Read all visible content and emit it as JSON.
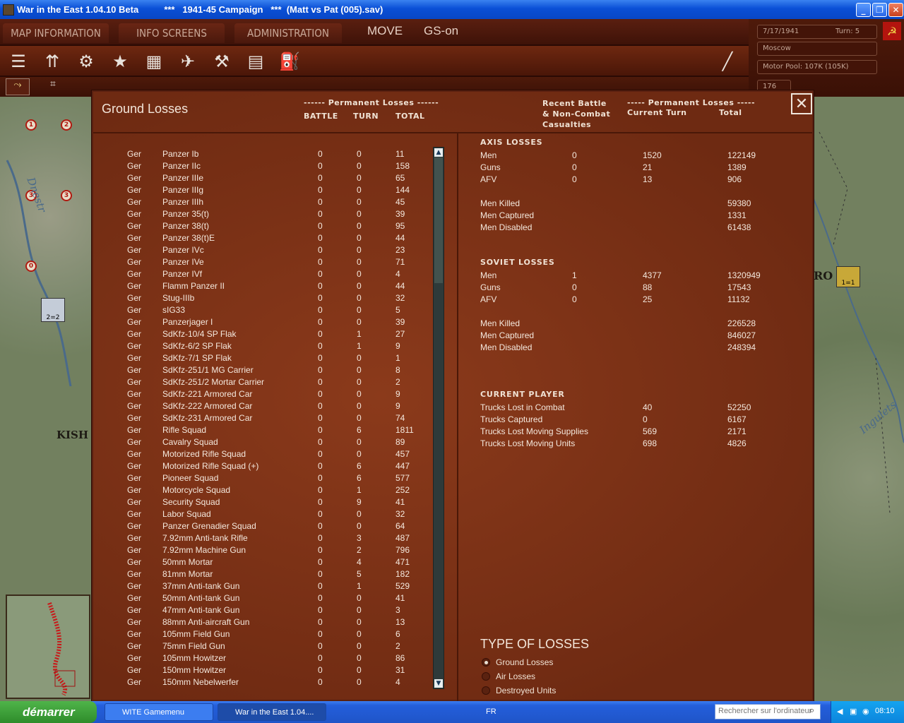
{
  "window": {
    "title": "War in the East 1.04.10 Beta          ***   1941-45 Campaign   ***  (Matt vs Pat (005).sav)"
  },
  "topbar": {
    "menus": [
      "MAP INFORMATION",
      "INFO SCREENS",
      "ADMINISTRATION"
    ],
    "mode": "MOVE",
    "gs": "GS-on"
  },
  "info": {
    "date": "7/17/1941",
    "turn": "Turn: 5",
    "location": "Moscow",
    "motor_pool": "Motor Pool: 107K (105K)",
    "count": "176"
  },
  "dialog": {
    "title": "Ground Losses",
    "left_header_group": "------ Permanent Losses ------",
    "col_battle": "BATTLE",
    "col_turn": "TURN",
    "col_total": "TOTAL",
    "right_header_1": "Recent Battle\n& Non-Combat\nCasualties",
    "right_header_group": "----- Permanent Losses -----",
    "right_col_current": "Current Turn",
    "right_col_total": "Total",
    "close": "✕"
  },
  "rows": [
    [
      "Ger",
      "Panzer Ib",
      "0",
      "0",
      "11"
    ],
    [
      "Ger",
      "Panzer IIc",
      "0",
      "0",
      "158"
    ],
    [
      "Ger",
      "Panzer IIIe",
      "0",
      "0",
      "65"
    ],
    [
      "Ger",
      "Panzer IIIg",
      "0",
      "0",
      "144"
    ],
    [
      "Ger",
      "Panzer IIIh",
      "0",
      "0",
      "45"
    ],
    [
      "Ger",
      "Panzer 35(t)",
      "0",
      "0",
      "39"
    ],
    [
      "Ger",
      "Panzer 38(t)",
      "0",
      "0",
      "95"
    ],
    [
      "Ger",
      "Panzer 38(t)E",
      "0",
      "0",
      "44"
    ],
    [
      "Ger",
      "Panzer IVc",
      "0",
      "0",
      "23"
    ],
    [
      "Ger",
      "Panzer IVe",
      "0",
      "0",
      "71"
    ],
    [
      "Ger",
      "Panzer IVf",
      "0",
      "0",
      "4"
    ],
    [
      "Ger",
      "Flamm Panzer II",
      "0",
      "0",
      "44"
    ],
    [
      "Ger",
      "Stug-IIIb",
      "0",
      "0",
      "32"
    ],
    [
      "Ger",
      "sIG33",
      "0",
      "0",
      "5"
    ],
    [
      "Ger",
      "Panzerjager I",
      "0",
      "0",
      "39"
    ],
    [
      "Ger",
      "SdKfz-10/4 SP Flak",
      "0",
      "1",
      "27"
    ],
    [
      "Ger",
      "SdKfz-6/2 SP Flak",
      "0",
      "1",
      "9"
    ],
    [
      "Ger",
      "SdKfz-7/1 SP Flak",
      "0",
      "0",
      "1"
    ],
    [
      "Ger",
      "SdKfz-251/1 MG Carrier",
      "0",
      "0",
      "8"
    ],
    [
      "Ger",
      "SdKfz-251/2 Mortar Carrier",
      "0",
      "0",
      "2"
    ],
    [
      "Ger",
      "SdKfz-221 Armored Car",
      "0",
      "0",
      "9"
    ],
    [
      "Ger",
      "SdKfz-222 Armored Car",
      "0",
      "0",
      "9"
    ],
    [
      "Ger",
      "SdKfz-231 Armored Car",
      "0",
      "0",
      "74"
    ],
    [
      "Ger",
      "Rifle Squad",
      "0",
      "6",
      "1811"
    ],
    [
      "Ger",
      "Cavalry Squad",
      "0",
      "0",
      "89"
    ],
    [
      "Ger",
      "Motorized Rifle Squad",
      "0",
      "0",
      "457"
    ],
    [
      "Ger",
      "Motorized Rifle Squad (+)",
      "0",
      "6",
      "447"
    ],
    [
      "Ger",
      "Pioneer Squad",
      "0",
      "6",
      "577"
    ],
    [
      "Ger",
      "Motorcycle Squad",
      "0",
      "1",
      "252"
    ],
    [
      "Ger",
      "Security Squad",
      "0",
      "9",
      "41"
    ],
    [
      "Ger",
      "Labor Squad",
      "0",
      "0",
      "32"
    ],
    [
      "Ger",
      "Panzer Grenadier Squad",
      "0",
      "0",
      "64"
    ],
    [
      "Ger",
      "7.92mm Anti-tank Rifle",
      "0",
      "3",
      "487"
    ],
    [
      "Ger",
      "7.92mm Machine Gun",
      "0",
      "2",
      "796"
    ],
    [
      "Ger",
      "50mm Mortar",
      "0",
      "4",
      "471"
    ],
    [
      "Ger",
      "81mm Mortar",
      "0",
      "5",
      "182"
    ],
    [
      "Ger",
      "37mm Anti-tank Gun",
      "0",
      "1",
      "529"
    ],
    [
      "Ger",
      "50mm Anti-tank Gun",
      "0",
      "0",
      "41"
    ],
    [
      "Ger",
      "47mm Anti-tank Gun",
      "0",
      "0",
      "3"
    ],
    [
      "Ger",
      "88mm Anti-aircraft Gun",
      "0",
      "0",
      "13"
    ],
    [
      "Ger",
      "105mm Field Gun",
      "0",
      "0",
      "6"
    ],
    [
      "Ger",
      "75mm Field Gun",
      "0",
      "0",
      "2"
    ],
    [
      "Ger",
      "105mm Howitzer",
      "0",
      "0",
      "86"
    ],
    [
      "Ger",
      "150mm Howitzer",
      "0",
      "0",
      "31"
    ],
    [
      "Ger",
      "150mm Nebelwerfer",
      "0",
      "0",
      "4"
    ]
  ],
  "axis": {
    "header": "AXIS LOSSES",
    "rows": [
      [
        "Men",
        "0",
        "1520",
        "122149"
      ],
      [
        "Guns",
        "0",
        "21",
        "1389"
      ],
      [
        "AFV",
        "0",
        "13",
        "906"
      ]
    ],
    "casualties": [
      [
        "Men Killed",
        "59380"
      ],
      [
        "Men Captured",
        "1331"
      ],
      [
        "Men Disabled",
        "61438"
      ]
    ]
  },
  "soviet": {
    "header": "SOVIET LOSSES",
    "rows": [
      [
        "Men",
        "1",
        "4377",
        "1320949"
      ],
      [
        "Guns",
        "0",
        "88",
        "17543"
      ],
      [
        "AFV",
        "0",
        "25",
        "11132"
      ]
    ],
    "casualties": [
      [
        "Men Killed",
        "226528"
      ],
      [
        "Men Captured",
        "846027"
      ],
      [
        "Men Disabled",
        "248394"
      ]
    ]
  },
  "current_player": {
    "header": "CURRENT PLAYER",
    "rows": [
      [
        "Trucks Lost in Combat",
        "40",
        "52250"
      ],
      [
        "Trucks Captured",
        "0",
        "6167"
      ],
      [
        "Trucks Lost Moving Supplies",
        "569",
        "2171"
      ],
      [
        "Trucks Lost Moving Units",
        "698",
        "4826"
      ]
    ]
  },
  "types": {
    "title": "TYPE OF LOSSES",
    "options": [
      "Ground Losses",
      "Air Losses",
      "Destroyed Units"
    ],
    "selected": 0
  },
  "map": {
    "labels": [
      "KISH",
      "Dnestr",
      "Ingulets",
      "RO"
    ]
  },
  "taskbar": {
    "start": "démarrer",
    "tasks": [
      "WITE Gamemenu",
      "War in the East 1.04...."
    ],
    "lang": "FR",
    "search_placeholder": "Rechercher sur l'ordinateur",
    "clock": "08:10"
  }
}
